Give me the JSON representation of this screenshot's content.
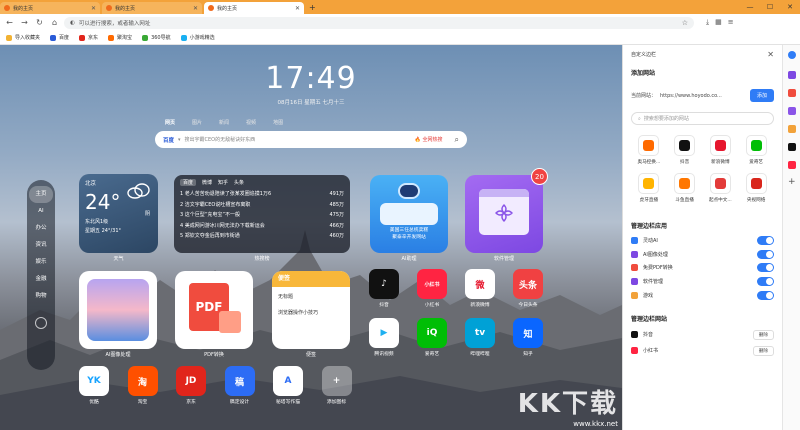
{
  "tabs": [
    {
      "title": "我的主页",
      "active": false
    },
    {
      "title": "我的主页",
      "active": false
    },
    {
      "title": "我的主页",
      "active": true
    }
  ],
  "omnibox_placeholder": "可以进行搜索，或者输入网址",
  "bookmarks": [
    {
      "label": "导入收藏夹",
      "color": "#f2b233"
    },
    {
      "label": "百度",
      "color": "#2a5bd7"
    },
    {
      "label": "京东",
      "color": "#e1251b"
    },
    {
      "label": "聚淘宝",
      "color": "#ff6a00"
    },
    {
      "label": "360导航",
      "color": "#3aa935"
    },
    {
      "label": "小游戏精选",
      "color": "#19b0f2"
    }
  ],
  "ntp": {
    "time": "17:49",
    "date": "08月16日 星期五 七月十三",
    "search_tabs": [
      "网页",
      "图片",
      "新闻",
      "视频",
      "地图"
    ],
    "search_engine": "百度",
    "search_placeholder": "搜出宇霸CEO的无敌秘诀好东西",
    "search_hot": "全网热搜",
    "categories": [
      "主页",
      "AI",
      "办公",
      "资讯",
      "娱乐",
      "金融",
      "购物"
    ],
    "weather": {
      "city": "北京",
      "temp": "24°",
      "cond": "阴",
      "wind": "东北风1级",
      "day": "星期五 24°/31°",
      "label": "天气"
    },
    "hot": {
      "tabs": [
        "百度",
        "微博",
        "知乎",
        "头条"
      ],
      "items": [
        {
          "t": "1 老人苦苦劝退陪读了张某发圈追摸1万6",
          "c": "491万"
        },
        {
          "t": "2 洁文宇霸CEO说吐槽宣布离职",
          "c": "485万"
        },
        {
          "t": "3 这个巨型“充电宝”不一般",
          "c": "475万"
        },
        {
          "t": "4 美成网问游冰川网无法办下载新运会",
          "c": "466万"
        },
        {
          "t": "5 郑钦文夺金后再到市街通",
          "c": "460万"
        }
      ],
      "label": "热搜榜"
    },
    "ai_caption": "美国三任总统卖糕\n聚泰辛开发网站",
    "ai_label": "AI助理",
    "soft_label": "软件管理",
    "soft_badge": "20",
    "img_label": "AI图像处理",
    "pdf_label": "PDF转换",
    "pdf_text": "PDF",
    "note": {
      "head": "便签",
      "l1": "无标题",
      "l2": "浏览器操作小技巧",
      "label": "便签"
    },
    "apps_row1": [
      {
        "label": "抖音",
        "color": "#111",
        "glyph": "♪"
      },
      {
        "label": "小红书",
        "color": "#ff2442",
        "glyph": "小红书"
      },
      {
        "label": "新浪微博",
        "color": "#fff",
        "glyph": "微",
        "fg": "#e6162d"
      },
      {
        "label": "今日头条",
        "color": "#f04142",
        "glyph": "头条"
      }
    ],
    "apps_row2": [
      {
        "label": "腾讯视频",
        "color": "#fff",
        "glyph": "▶",
        "fg": "#1eb0f0"
      },
      {
        "label": "爱奇艺",
        "color": "#00be06",
        "glyph": "iQ"
      },
      {
        "label": "哔哩哔哩",
        "color": "#00a1d6",
        "glyph": "tv"
      },
      {
        "label": "知乎",
        "color": "#0a66ff",
        "glyph": "知"
      }
    ],
    "apps_row3": [
      {
        "label": "优酷",
        "color": "#fff",
        "glyph": "YK",
        "fg": "#16a3ff"
      },
      {
        "label": "淘宝",
        "color": "#ff5000",
        "glyph": "淘"
      },
      {
        "label": "京东",
        "color": "#e1251b",
        "glyph": "JD"
      },
      {
        "label": "稿定设计",
        "color": "#2c6cf5",
        "glyph": "稿"
      },
      {
        "label": "秘塔写作猫",
        "color": "#fff",
        "glyph": "A",
        "fg": "#2c6cf5"
      },
      {
        "label": "添加图标",
        "color": "rgba(255,255,255,0.35)",
        "glyph": "+"
      }
    ]
  },
  "panel": {
    "head": "自定义边栏",
    "title": "添加网站",
    "cur_label": "当前网站：",
    "cur_url": "https://www.hoyodo.co...",
    "add": "添加",
    "search_placeholder": "搜索想要添加的网站",
    "sites": [
      {
        "label": "奥马控换...",
        "color": "#ff6a00"
      },
      {
        "label": "抖音",
        "color": "#111"
      },
      {
        "label": "新浪微博",
        "color": "#e6162d"
      },
      {
        "label": "爱奇艺",
        "color": "#00be06"
      },
      {
        "label": "虎牙直播",
        "color": "#ffb400"
      },
      {
        "label": "斗鱼直播",
        "color": "#ff7700"
      },
      {
        "label": "起点中文...",
        "color": "#e33b39"
      },
      {
        "label": "央视网络",
        "color": "#d9261c"
      }
    ],
    "apps_title": "管理边栏应用",
    "apps": [
      {
        "label": "灵动AI",
        "color": "#2f7cf6"
      },
      {
        "label": "AI图像处理",
        "color": "#7d48e2"
      },
      {
        "label": "免费PDF转换",
        "color": "#f04c3e"
      },
      {
        "label": "软件管理",
        "color": "#7d48e2"
      },
      {
        "label": "游戏",
        "color": "#f2a23a"
      }
    ],
    "sites_title": "管理边栏网站",
    "managed": [
      {
        "label": "抖音",
        "color": "#111"
      },
      {
        "label": "小红书",
        "color": "#ff2442"
      }
    ],
    "delete": "删除"
  },
  "watermark": {
    "big": "KK下载",
    "small": "www.kkx.net"
  }
}
